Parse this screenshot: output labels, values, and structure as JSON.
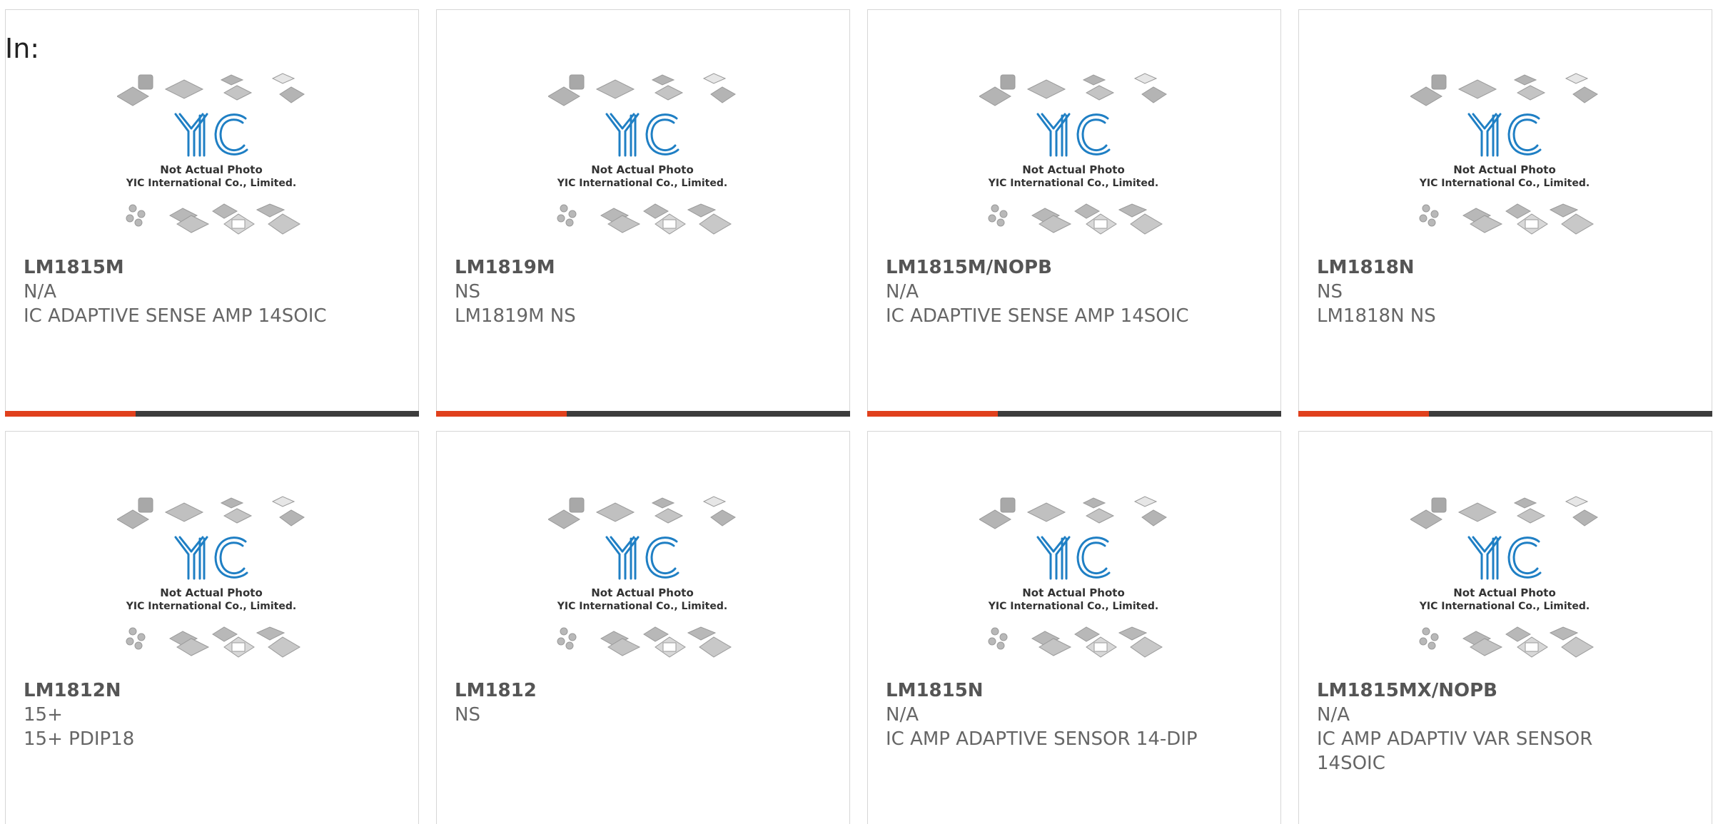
{
  "header": {
    "in_label": "In:"
  },
  "placeholder": {
    "line1": "Not Actual Photo",
    "line2": "YIC International Co., Limited.",
    "logo": "YIC"
  },
  "colors": {
    "accent": "#e0401c",
    "bar": "#3c3c3c",
    "logo_blue": "#1f7fc4",
    "text": "#666666"
  },
  "products": [
    {
      "part": "LM1815M",
      "brand": "N/A",
      "desc": "IC ADAPTIVE SENSE AMP 14SOIC"
    },
    {
      "part": "LM1819M",
      "brand": "NS",
      "desc": "LM1819M NS"
    },
    {
      "part": "LM1815M/NOPB",
      "brand": "N/A",
      "desc": "IC ADAPTIVE SENSE AMP 14SOIC"
    },
    {
      "part": "LM1818N",
      "brand": "NS",
      "desc": "LM1818N NS"
    },
    {
      "part": "LM1812N",
      "brand": "15+",
      "desc": "15+ PDIP18"
    },
    {
      "part": "LM1812",
      "brand": "NS",
      "desc": ""
    },
    {
      "part": "LM1815N",
      "brand": "N/A",
      "desc": "IC AMP ADAPTIVE SENSOR 14-DIP"
    },
    {
      "part": "LM1815MX/NOPB",
      "brand": "N/A",
      "desc": "IC AMP ADAPTIV VAR SENSOR 14SOIC"
    }
  ]
}
